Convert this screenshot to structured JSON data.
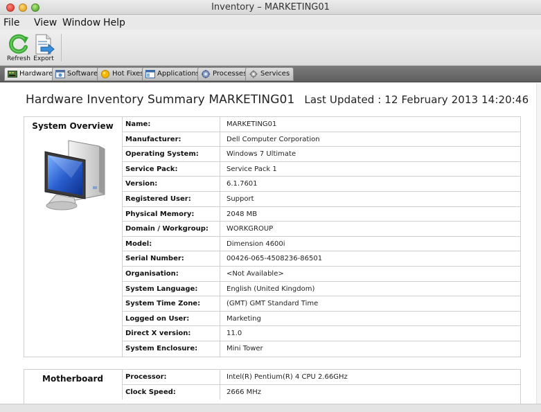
{
  "window": {
    "title": "Inventory – MARKETING01"
  },
  "menu": {
    "items": [
      "File",
      "View",
      "Window",
      "Help"
    ]
  },
  "toolbar": {
    "refresh_label": "Refresh",
    "export_label": "Export"
  },
  "tabs": [
    {
      "label": "Hardware",
      "icon": "hardware-icon",
      "active": true
    },
    {
      "label": "Software",
      "icon": "software-icon",
      "active": false
    },
    {
      "label": "Hot Fixes",
      "icon": "hotfixes-icon",
      "active": false
    },
    {
      "label": "Applications",
      "icon": "applications-icon",
      "active": false
    },
    {
      "label": "Processes",
      "icon": "processes-icon",
      "active": false
    },
    {
      "label": "Services",
      "icon": "services-icon",
      "active": false
    }
  ],
  "summary": {
    "title": "Hardware Inventory Summary MARKETING01",
    "last_updated": "Last Updated : 12 February 2013 14:20:46"
  },
  "system_overview": {
    "title": "System Overview",
    "rows": [
      {
        "label": "Name:",
        "value": "MARKETING01"
      },
      {
        "label": "Manufacturer:",
        "value": "Dell Computer Corporation"
      },
      {
        "label": "Operating System:",
        "value": "Windows 7 Ultimate"
      },
      {
        "label": "Service Pack:",
        "value": "Service Pack 1"
      },
      {
        "label": "Version:",
        "value": "6.1.7601"
      },
      {
        "label": "Registered User:",
        "value": "Support"
      },
      {
        "label": "Physical Memory:",
        "value": "2048 MB"
      },
      {
        "label": "Domain / Workgroup:",
        "value": "WORKGROUP"
      },
      {
        "label": "Model:",
        "value": "Dimension 4600i"
      },
      {
        "label": "Serial Number:",
        "value": "00426-065-4508236-86501"
      },
      {
        "label": "Organisation:",
        "value": "<Not Available>"
      },
      {
        "label": "System Language:",
        "value": "English (United Kingdom)"
      },
      {
        "label": "System Time Zone:",
        "value": "(GMT) GMT Standard Time"
      },
      {
        "label": "Logged on User:",
        "value": "Marketing"
      },
      {
        "label": "Direct X version:",
        "value": "11.0"
      },
      {
        "label": "System Enclosure:",
        "value": "Mini Tower"
      }
    ]
  },
  "motherboard": {
    "title": "Motherboard",
    "rows": [
      {
        "label": "Processor:",
        "value": "Intel(R) Pentium(R) 4 CPU 2.66GHz"
      },
      {
        "label": "Clock Speed:",
        "value": "2666 MHz"
      }
    ]
  }
}
